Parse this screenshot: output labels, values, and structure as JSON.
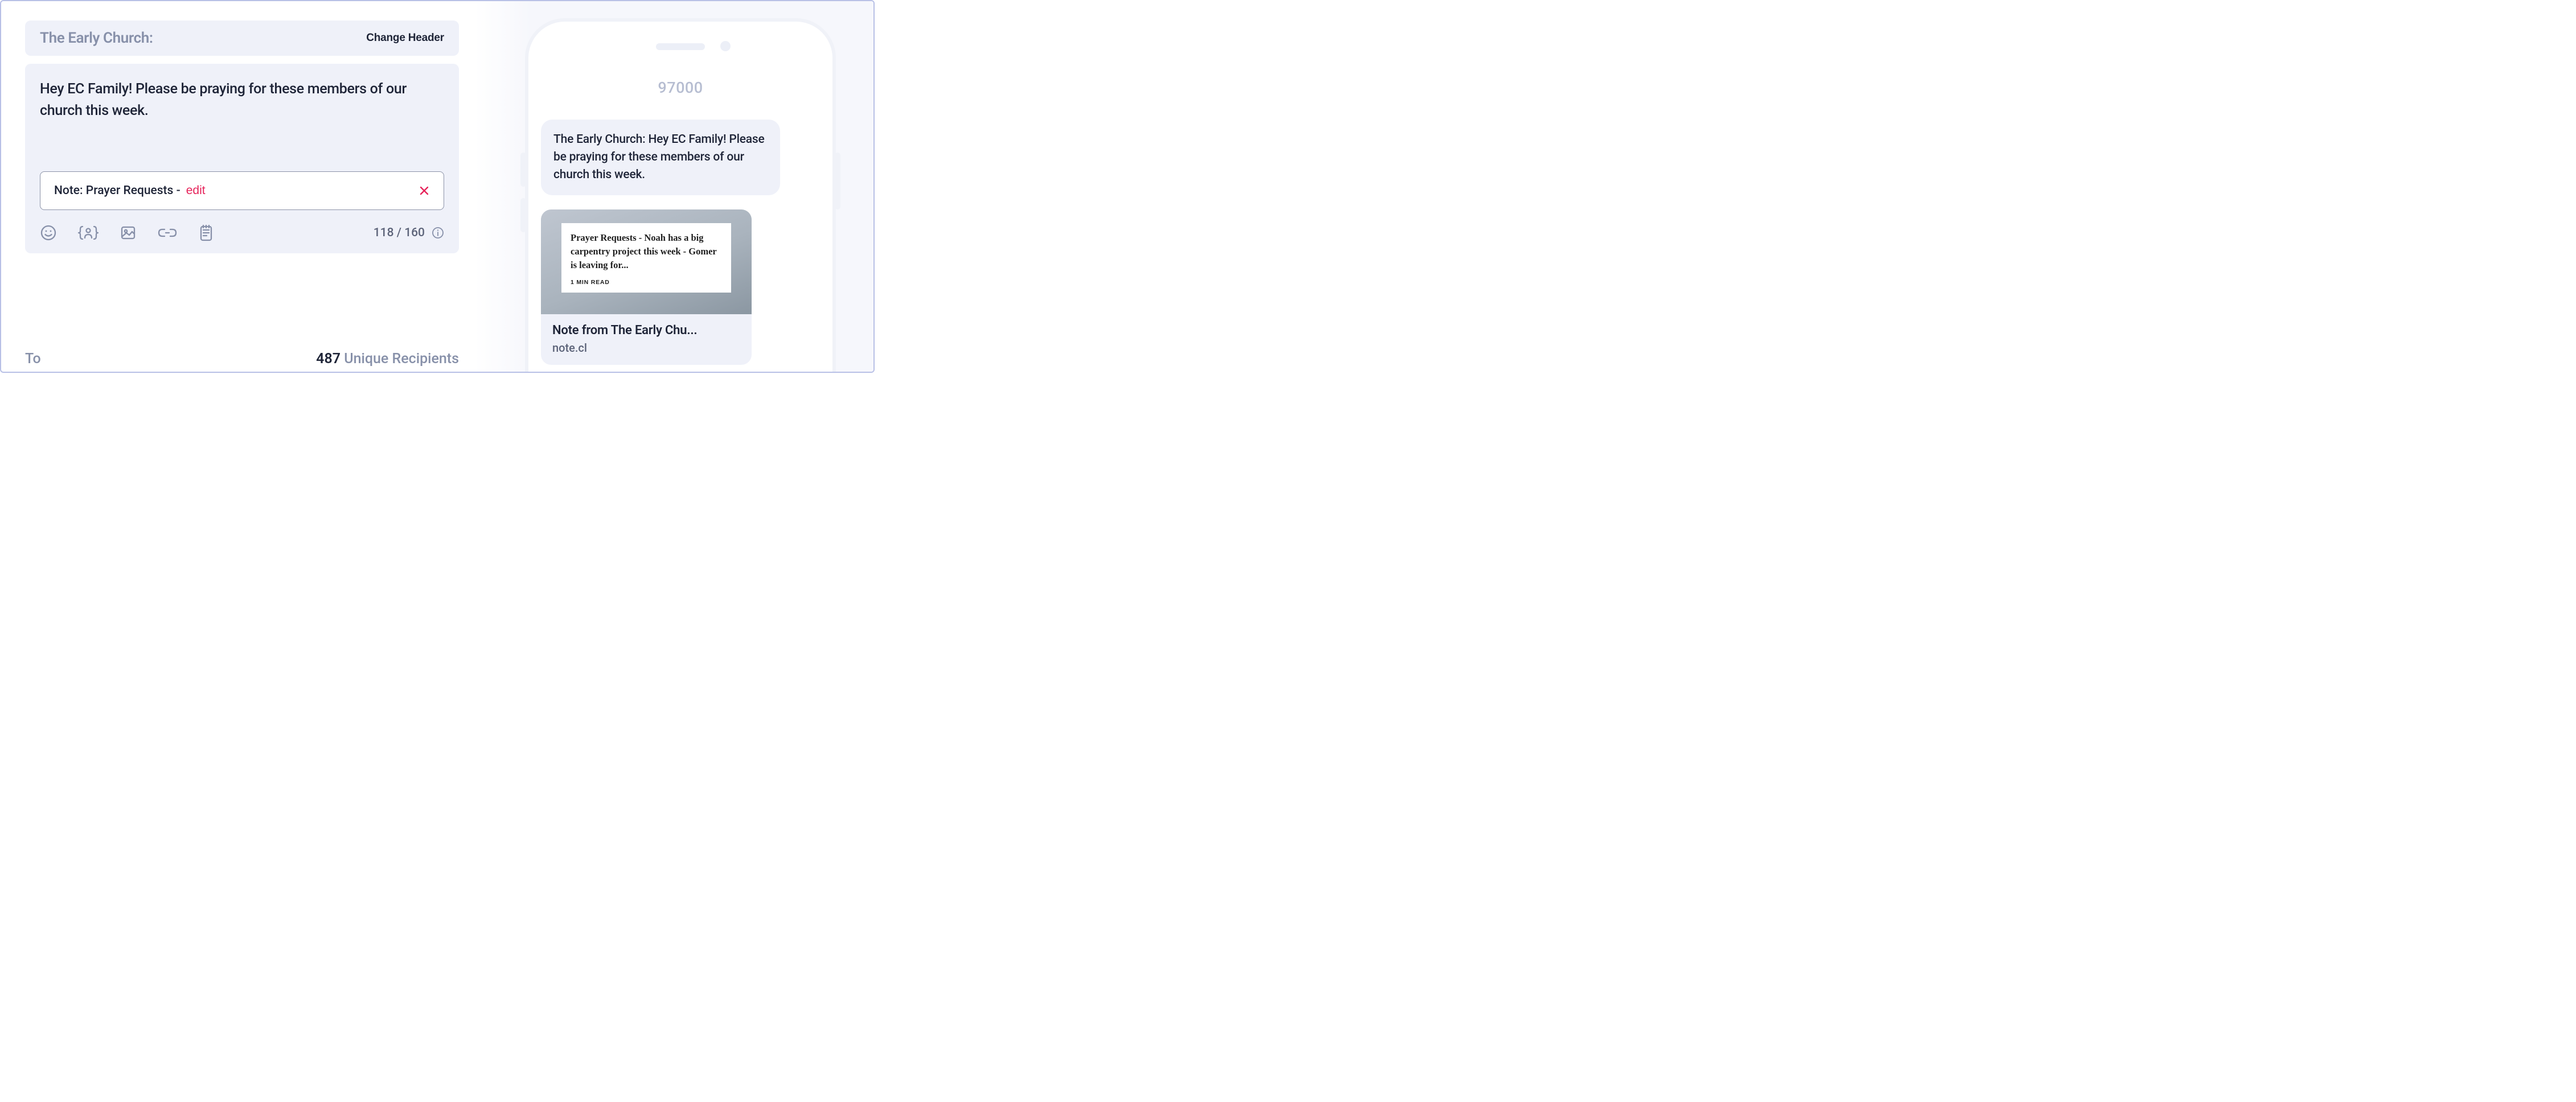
{
  "composer": {
    "header_title": "The Early Church:",
    "change_header_label": "Change Header",
    "body_text": "Hey EC Family! Please be praying for these members of our church this week.",
    "note_chip": {
      "label": "Note: Prayer Requests -",
      "edit_label": "edit"
    },
    "char_count": "118 / 160"
  },
  "toolbar_icons": {
    "emoji": "emoji-icon",
    "merge": "merge-field-icon",
    "image": "image-icon",
    "link": "link-icon",
    "note": "note-icon"
  },
  "to_row": {
    "label": "To",
    "count": "487",
    "suffix": " Unique Recipients"
  },
  "preview": {
    "sender_number": "97000",
    "bubble_text": "The Early Church: Hey EC Family! Please be praying for these members of our church this week.",
    "link_card": {
      "hero_text": "Prayer Requests - Noah has a big carpentry project this week - Gomer is leaving for...",
      "read_time": "1 MIN READ",
      "title": "Note from The Early Chu...",
      "url": "note.cl"
    }
  }
}
